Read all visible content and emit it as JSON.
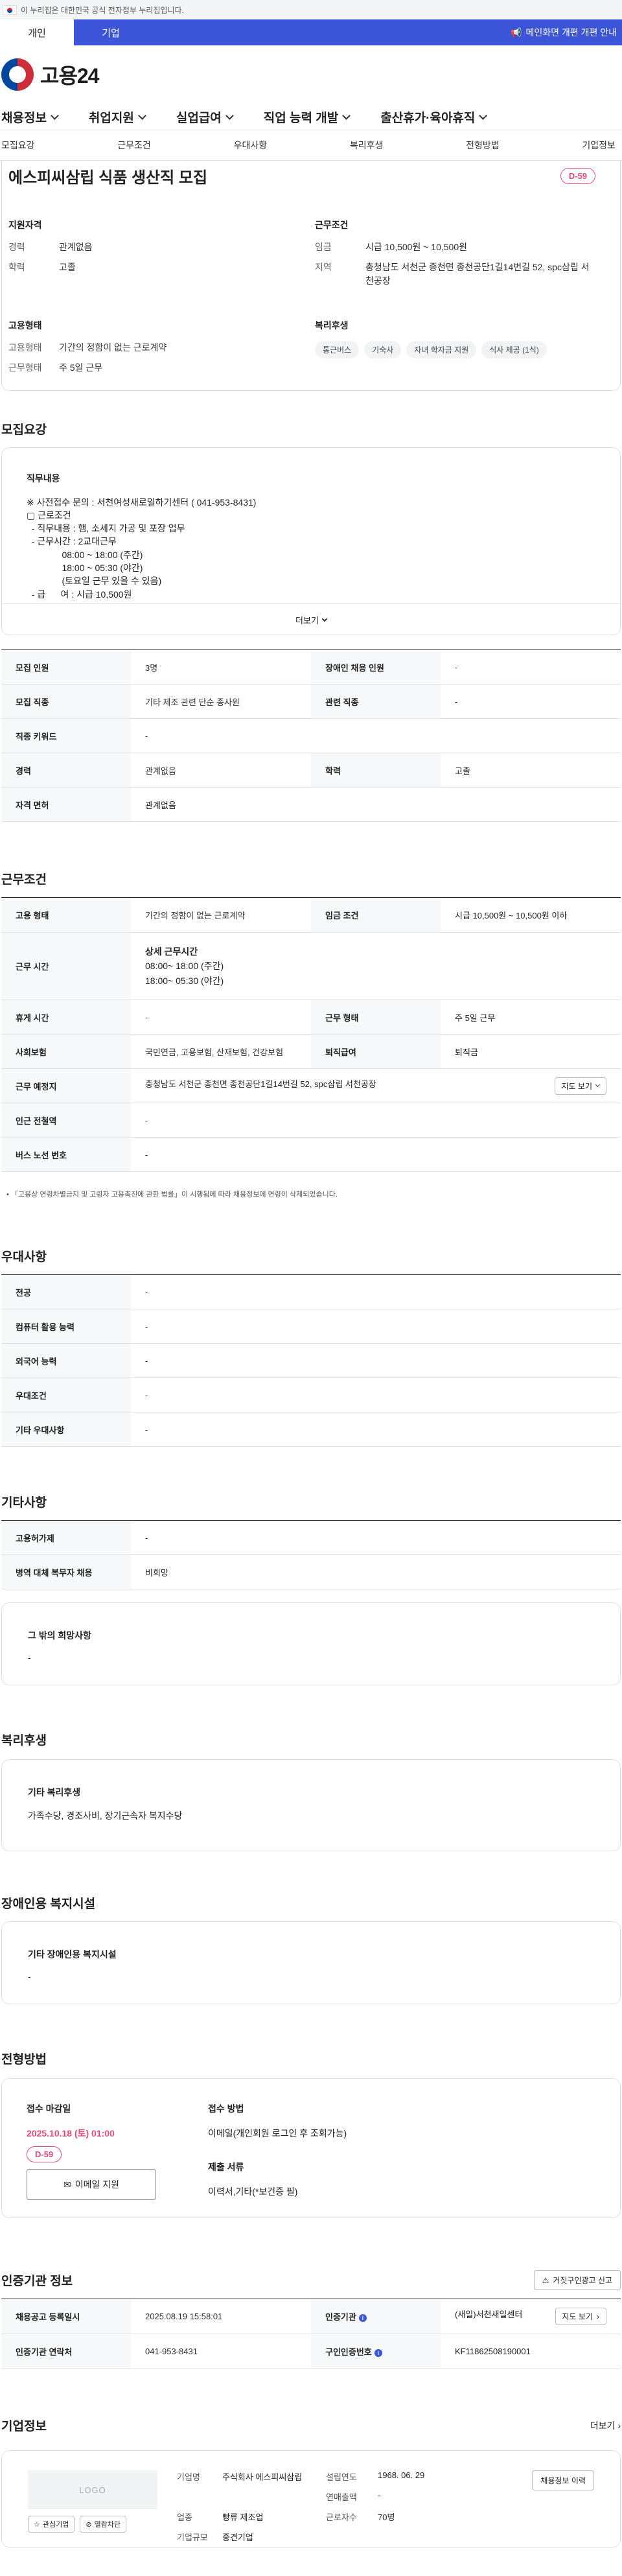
{
  "gov_banner": {
    "text": "이 누리집은 대한민국 공식 전자정부 누리집입니다."
  },
  "user_tabs": {
    "personal": "개인",
    "company": "기업",
    "pr_banner": "메인화면 개편 개편 안내"
  },
  "logo": {
    "text": "고용24"
  },
  "gnb": [
    "채용정보",
    "취업지원",
    "실업급여",
    "직업 능력 개발",
    "출산휴가·육아휴직"
  ],
  "anchor_tabs": [
    "모집요강",
    "근무조건",
    "우대사항",
    "복리후생",
    "전형방법",
    "기업정보"
  ],
  "summary": {
    "title": "에스피씨삼립 식품 생산직 모집",
    "dday": "D-59",
    "qual_heading": "지원자격",
    "career_k": "경력",
    "career_v": "관계없음",
    "edu_k": "학력",
    "edu_v": "고졸",
    "emp_heading": "고용형태",
    "emptype_k": "고용형태",
    "emptype_v": "기간의 정함이 없는 근로계약",
    "worktype_k": "근무형태",
    "worktype_v": "주 5일 근무",
    "cond_heading": "근무조건",
    "wage_k": "임금",
    "wage_v": "시급 10,500원 ~ 10,500원",
    "region_k": "지역",
    "region_v": "충청남도 서천군 종천면 종천공단1길14번길 52, spc삼립 서천공장",
    "welfare_heading": "복리후생",
    "welfare_chips": [
      "통근버스",
      "기숙사",
      "자녀 학자금 지원",
      "식사 제공 (1식)"
    ]
  },
  "recruit": {
    "section_title": "모집요강",
    "box_heading": "직무내용",
    "body": "※ 사전접수 문의 : 서천여성새로일하기센터 ( 041-953-8431)\n▢ 근로조건\n  - 직무내용 : 햄, 소세지 가공 및 포장 업무\n  - 근무시간 : 2교대근무\n              08:00 ~ 18:00 (주간)\n              18:00 ~ 05:30 (야간)\n              (토요일 근무 있을 수 있음)\n  - 급      여 : 시급 10,500원",
    "more_label": "더보기",
    "rows": [
      [
        "모집 인원",
        "3명",
        "장애인 채용 인원",
        "-"
      ],
      [
        "모집 직종",
        "기타 제조 관련 단순 종사원",
        "관련 직종",
        "-"
      ],
      [
        "직종 키워드",
        "-"
      ],
      [
        "경력",
        "관계없음",
        "학력",
        "고졸"
      ],
      [
        "자격 면허",
        "관계없음"
      ]
    ]
  },
  "conditions": {
    "section_title": "근무조건",
    "emp_k": "고용 형태",
    "emp_v": "기간의 정함이 없는 근로계약",
    "wagecond_k": "임금 조건",
    "wagecond_v": "시급 10,500원 ~ 10,500원 이하",
    "hours_k": "근무 시간",
    "hours_title": "상세 근무시간",
    "hours_l1": "08:00~ 18:00 (주간)",
    "hours_l2": "18:00~ 05:30 (야간)",
    "rest_k": "휴게 시간",
    "rest_v": "-",
    "form_k": "근무 형태",
    "form_v": "주 5일 근무",
    "ins_k": "사회보험",
    "ins_v": "국민연금, 고용보험, 산재보험, 건강보험",
    "sev_k": "퇴직급여",
    "sev_v": "퇴직금",
    "place_k": "근무 예정지",
    "place_v": "충청남도 서천군 종천면 종천공단1길14번길 52, spc삼립 서천공장",
    "map_btn": "지도 보기",
    "subway_k": "인근 전철역",
    "subway_v": "-",
    "bus_k": "버스 노선 번호",
    "bus_v": "-",
    "note": "「고용상 연령차별금지 및 고령자 고용촉진에 관한 법률」이 시행됨에 따라 채용정보에 연령이 삭제되었습니다."
  },
  "preference": {
    "section_title": "우대사항",
    "rows": [
      [
        "전공",
        "-"
      ],
      [
        "컴퓨터 활용 능력",
        "-"
      ],
      [
        "외국어 능력",
        "-"
      ],
      [
        "우대조건",
        "-"
      ],
      [
        "기타 우대사항",
        "-"
      ]
    ]
  },
  "etc": {
    "section_title": "기타사항",
    "rows": [
      [
        "고용허가제",
        "-"
      ],
      [
        "병역 대체 복무자 채용",
        "비희망"
      ]
    ],
    "wish_heading": "그 밖의 희망사항",
    "wish_value": "-"
  },
  "welfare": {
    "section_title": "복리후생",
    "heading": "기타 복리후생",
    "value": "가족수당, 경조사비, 장기근속자 복지수당"
  },
  "disabled": {
    "section_title": "장애인용 복지시설",
    "heading": "기타 장애인용 복지시설",
    "value": "-"
  },
  "process": {
    "section_title": "전형방법",
    "deadline_heading": "접수 마감일",
    "deadline_value": "2025.10.18 (토) 01:00",
    "dday": "D-59",
    "email_btn": "이메일 지원",
    "method_heading": "접수 방법",
    "method_value": "이메일(개인회원 로그인 후 조회가능)",
    "docs_heading": "제출 서류",
    "docs_value": "이력서,기타(*보건증 필)"
  },
  "cert": {
    "section_title": "인증기관 정보",
    "report_btn": "거짓구인광고 신고",
    "reg_k": "채용공고 등록일시",
    "reg_v": "2025.08.19 15:58:01",
    "agency_k": "인증기관",
    "agency_v": "(새일)서천새일센터",
    "map_btn": "지도 보기",
    "contact_k": "인증기관 연락처",
    "contact_v": "041-953-8431",
    "authno_k": "구인인증번호",
    "authno_v": "KF11862508190001"
  },
  "company": {
    "section_title": "기업정보",
    "more_label": "더보기",
    "logo_placeholder": "LOGO",
    "fav_btn": "관심기업",
    "block_btn": "열람차단",
    "name_k": "기업명",
    "name_v": "주식회사 에스피씨삼립",
    "year_k": "설립연도",
    "year_v": "1968. 06. 29",
    "sales_k": "연매출액",
    "sales_v": "-",
    "industry_k": "업종",
    "industry_v": "빵류 제조업",
    "emp_k": "근로자수",
    "emp_v": "70명",
    "size_k": "기업규모",
    "size_v": "중견기업",
    "history_btn": "채용정보 이력"
  },
  "colors": {
    "brand": "#3b54d8",
    "accent": "#e64a7a"
  }
}
